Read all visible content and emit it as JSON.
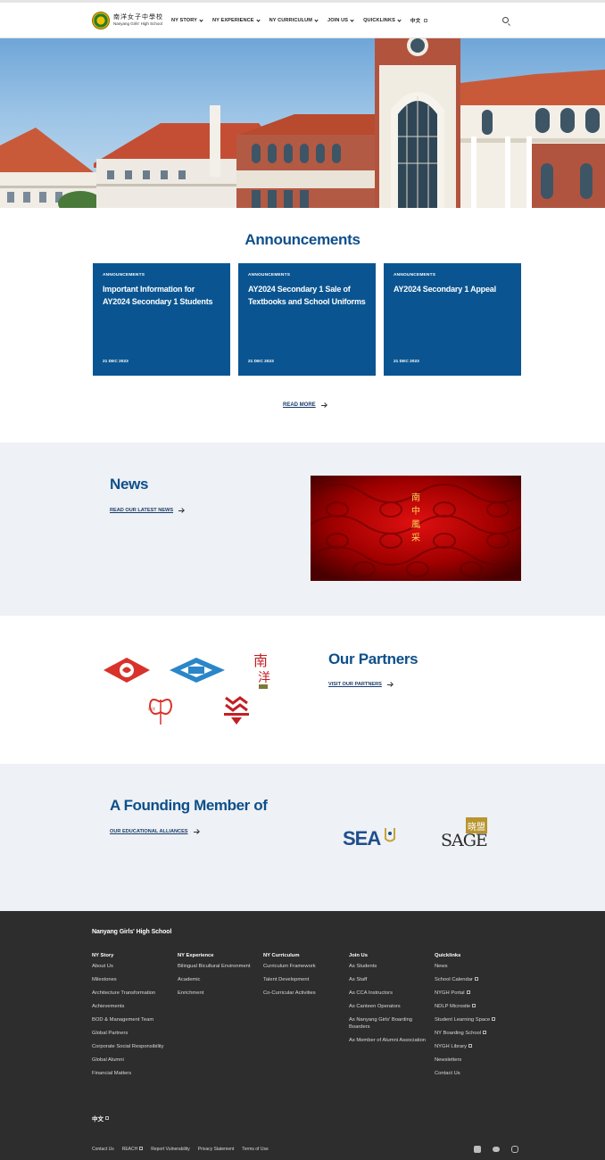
{
  "header": {
    "logo_cn": "南洋女子中學校",
    "logo_en": "Nanyang Girls' High School",
    "nav": [
      "NY STORY",
      "NY EXPERIENCE",
      "NY CURRICULUM",
      "JOIN US",
      "QUICKLINKS"
    ],
    "lang": "中文"
  },
  "announcements": {
    "title": "Announcements",
    "cards": [
      {
        "tag": "ANNOUNCEMENTS",
        "title": "Important Information for AY2024 Secondary 1 Students",
        "date": "21 DEC 2023"
      },
      {
        "tag": "ANNOUNCEMENTS",
        "title": "AY2024 Secondary 1 Sale of Textbooks and School Uniforms",
        "date": "21 DEC 2023"
      },
      {
        "tag": "ANNOUNCEMENTS",
        "title": "AY2024 Secondary 1 Appeal",
        "date": "21 DEC 2023"
      }
    ],
    "read_more": "READ MORE"
  },
  "news": {
    "title": "News",
    "link": "READ OUR LATEST NEWS",
    "image_text": [
      "南",
      "中",
      "風",
      "采"
    ]
  },
  "partners": {
    "title": "Our Partners",
    "link": "VISIT OUR PARTNERS"
  },
  "founding": {
    "title": "A Founding Member of",
    "link": "OUR EDUCATIONAL ALLIANCES"
  },
  "footer": {
    "school": "Nanyang Girls' High School",
    "columns": [
      {
        "title": "NY Story",
        "links": [
          "About Us",
          "Milestones",
          "Architecture Transformation",
          "Achievements",
          "BOD & Management Team",
          "Global Partners",
          "Corporate Social Responsibility",
          "Global Alumni",
          "Financial Matters"
        ]
      },
      {
        "title": "NY Experience",
        "links": [
          "Bilingual Bicultural Environment",
          "Academic",
          "Enrichment"
        ]
      },
      {
        "title": "NY Curriculum",
        "links": [
          "Curriculum Framework",
          "Talent Development",
          "Co-Curricular Activities"
        ]
      },
      {
        "title": "Join Us",
        "links": [
          "As Students",
          "As Staff",
          "As CCA Instructors",
          "As Canteen Operators",
          "As Nanyang Girls' Boarding Boarders",
          "As Member of Alumni Association"
        ]
      },
      {
        "title": "Quicklinks",
        "links": [
          "News",
          "School Calendar",
          "NYGH Portal",
          "NDLP Microsite",
          "Student Learning Space",
          "NY Boarding School",
          "NYGH Library",
          "Newsletters",
          "Contact Us"
        ]
      }
    ],
    "lang": "中文",
    "bottom": [
      "Contact Us",
      "REACH",
      "Report Vulnerability",
      "Privacy Statement",
      "Terms of Use"
    ]
  }
}
